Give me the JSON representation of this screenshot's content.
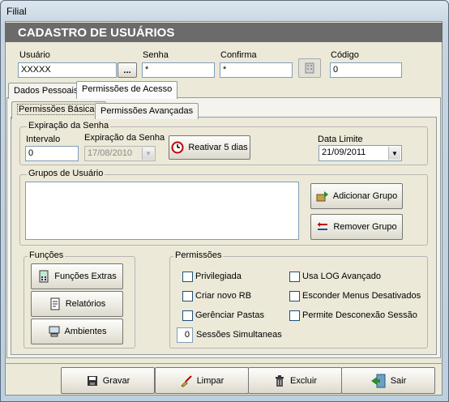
{
  "window": {
    "title": "Filial"
  },
  "header": {
    "title": "CADASTRO DE USUÁRIOS"
  },
  "top_fields": {
    "usuario_label": "Usuário",
    "usuario_value": "XXXXX",
    "browse_label": "...",
    "senha_label": "Senha",
    "senha_value": "*",
    "confirma_label": "Confirma",
    "confirma_value": "*",
    "codigo_label": "Código",
    "codigo_value": "0"
  },
  "main_tabs": [
    "Dados Pessoais",
    "Permissões de Acesso"
  ],
  "sub_tabs": [
    "Permissões Básicas",
    "Permissões Avançadas"
  ],
  "expiracao": {
    "title": "Expiração da Senha",
    "intervalo_label": "Intervalo",
    "intervalo_value": "0",
    "expiracao_label": "Expiração da Senha",
    "expiracao_value": "17/08/2010",
    "reativar_label": "Reativar 5 dias",
    "data_limite_label": "Data Limite",
    "data_limite_value": "21/09/2011"
  },
  "grupos": {
    "title": "Grupos de Usuário",
    "adicionar_label": "Adicionar Grupo",
    "remover_label": "Remover Grupo"
  },
  "funcoes": {
    "title": "Funções",
    "buttons": [
      "Funções Extras",
      "Relatórios",
      "Ambientes"
    ]
  },
  "permissoes": {
    "title": "Permissões",
    "left": [
      "Privilegiada",
      "Criar novo RB",
      "Gerênciar Pastas"
    ],
    "right": [
      "Usa LOG Avançado",
      "Esconder Menus Desativados",
      "Permite Desconexão Sessão"
    ],
    "sessoes_value": "0",
    "sessoes_label": "Sessões Simultaneas"
  },
  "footer": {
    "gravar": "Gravar",
    "limpar": "Limpar",
    "excluir": "Excluir",
    "sair": "Sair"
  }
}
